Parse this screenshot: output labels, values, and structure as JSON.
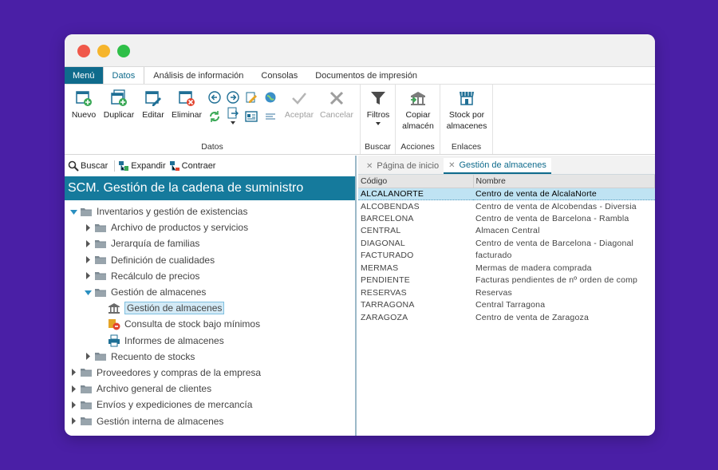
{
  "menubar": {
    "menu_label": "Menú",
    "tabs": [
      "Datos",
      "Análisis de información",
      "Consolas",
      "Documentos de impresión"
    ]
  },
  "ribbon": {
    "datos": {
      "label": "Datos",
      "nuevo": "Nuevo",
      "duplicar": "Duplicar",
      "editar": "Editar",
      "eliminar": "Eliminar",
      "aceptar": "Aceptar",
      "cancelar": "Cancelar"
    },
    "buscar": {
      "label": "Buscar",
      "filtros": "Filtros"
    },
    "acciones": {
      "label": "Acciones",
      "copiar_1": "Copiar",
      "copiar_2": "almacén"
    },
    "enlaces": {
      "label": "Enlaces",
      "stock_1": "Stock por",
      "stock_2": "almacenes"
    }
  },
  "left_toolbar": {
    "buscar": "Buscar",
    "expandir": "Expandir",
    "contraer": "Contraer"
  },
  "tree": {
    "title": "SCM. Gestión de la cadena de suministro",
    "items": [
      "Inventarios y gestión de existencias",
      "Archivo de productos y servicios",
      "Jerarquía de familias",
      "Definición de cualidades",
      "Recálculo de precios",
      "Gestión de almacenes",
      "Gestión de almacenes",
      "Consulta de stock bajo mínimos",
      "Informes de almacenes",
      "Recuento de stocks",
      "Proveedores y compras de la empresa",
      "Archivo general de clientes",
      "Envíos y expediciones de mercancía",
      "Gestión interna de almacenes"
    ]
  },
  "doc_tabs": [
    "Página de inicio",
    "Gestión de almacenes"
  ],
  "grid": {
    "headers": [
      "Código",
      "Nombre"
    ],
    "rows": [
      [
        "ALCALANORTE",
        "Centro de venta de AlcalaNorte"
      ],
      [
        "ALCOBENDAS",
        "Centro de venta de Alcobendas - Diversia"
      ],
      [
        "BARCELONA",
        "Centro de venta de Barcelona - Rambla"
      ],
      [
        "CENTRAL",
        "Almacen Central"
      ],
      [
        "DIAGONAL",
        "Centro de venta de Barcelona - Diagonal"
      ],
      [
        "FACTURADO",
        "facturado"
      ],
      [
        "MERMAS",
        "Mermas de madera comprada"
      ],
      [
        "PENDIENTE",
        "Facturas pendientes de nº orden de comp"
      ],
      [
        "RESERVAS",
        "Reservas"
      ],
      [
        "TARRAGONA",
        "Central Tarragona"
      ],
      [
        "ZARAGOZA",
        "Centro de venta de Zaragoza"
      ]
    ]
  },
  "colors": {
    "accent": "#0f6b8c",
    "tree_header": "#157a9c",
    "selection": "#bfe3f3",
    "background": "#4a1fa6"
  }
}
